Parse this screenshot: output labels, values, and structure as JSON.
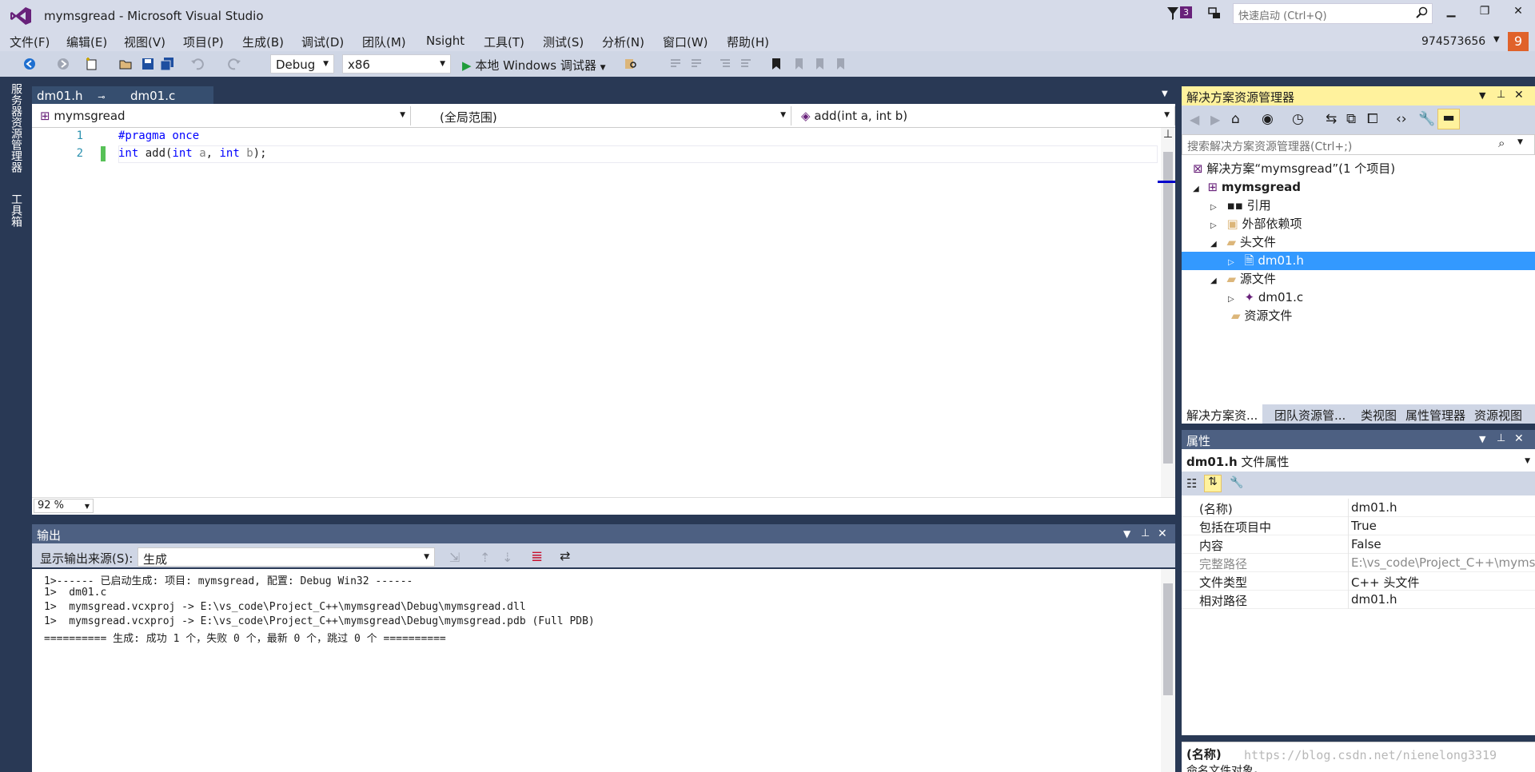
{
  "app": {
    "title": "mymsgread - Microsoft Visual Studio",
    "notification_count": "3",
    "quick_launch_placeholder": "快速启动 (Ctrl+Q)",
    "account": "974573656",
    "avatar_letter": "9"
  },
  "menu": [
    "文件(F)",
    "编辑(E)",
    "视图(V)",
    "项目(P)",
    "生成(B)",
    "调试(D)",
    "团队(M)",
    "Nsight",
    "工具(T)",
    "测试(S)",
    "分析(N)",
    "窗口(W)",
    "帮助(H)"
  ],
  "toolbar": {
    "config": "Debug",
    "platform": "x86",
    "run_label": "本地 Windows 调试器"
  },
  "left_rail": [
    "服务器资源管理器",
    "工具箱"
  ],
  "editor": {
    "tabs": [
      {
        "label": "dm01.h",
        "active": true
      },
      {
        "label": "dm01.c",
        "active": false
      }
    ],
    "nav_project": "mymsgread",
    "nav_scope": "(全局范围)",
    "nav_member": "add(int a, int b)",
    "lines": [
      {
        "num": "1",
        "text": "#pragma once"
      },
      {
        "num": "2",
        "text": "int add(int a, int b);"
      }
    ],
    "zoom": "92 %"
  },
  "output": {
    "title": "输出",
    "source_label": "显示输出来源(S):",
    "source_value": "生成",
    "lines": [
      "1>------ 已启动生成: 项目: mymsgread, 配置: Debug Win32 ------",
      "1>  dm01.c",
      "1>  mymsgread.vcxproj -> E:\\vs_code\\Project_C++\\mymsgread\\Debug\\mymsgread.dll",
      "1>  mymsgread.vcxproj -> E:\\vs_code\\Project_C++\\mymsgread\\Debug\\mymsgread.pdb (Full PDB)",
      "========== 生成: 成功 1 个，失败 0 个，最新 0 个，跳过 0 个 =========="
    ]
  },
  "solution_explorer": {
    "title": "解决方案资源管理器",
    "search_placeholder": "搜索解决方案资源管理器(Ctrl+;)",
    "nodes": [
      {
        "label": "解决方案“mymsgread”(1 个项目)",
        "depth": 0,
        "toggle": "",
        "icon": "solution-icon",
        "bold": false,
        "selected": false
      },
      {
        "label": "mymsgread",
        "depth": 1,
        "toggle": "◢",
        "icon": "project-icon",
        "bold": true,
        "selected": false
      },
      {
        "label": "引用",
        "depth": 2,
        "toggle": "▷",
        "icon": "references-icon",
        "bold": false,
        "selected": false
      },
      {
        "label": "外部依赖项",
        "depth": 2,
        "toggle": "▷",
        "icon": "external-deps-icon",
        "bold": false,
        "selected": false
      },
      {
        "label": "头文件",
        "depth": 2,
        "toggle": "◢",
        "icon": "folder-icon",
        "bold": false,
        "selected": false
      },
      {
        "label": "dm01.h",
        "depth": 3,
        "toggle": "▷",
        "icon": "header-file-icon",
        "bold": false,
        "selected": true
      },
      {
        "label": "源文件",
        "depth": 2,
        "toggle": "◢",
        "icon": "folder-icon",
        "bold": false,
        "selected": false
      },
      {
        "label": "dm01.c",
        "depth": 3,
        "toggle": "▷",
        "icon": "c-file-icon",
        "bold": false,
        "selected": false
      },
      {
        "label": "资源文件",
        "depth": 2,
        "toggle": "",
        "icon": "folder-icon",
        "bold": false,
        "selected": false
      }
    ],
    "bottom_tabs": [
      "解决方案资...",
      "团队资源管...",
      "类视图",
      "属性管理器",
      "资源视图"
    ]
  },
  "properties": {
    "title": "属性",
    "object_name": "dm01.h",
    "object_type": "文件属性",
    "rows": [
      {
        "key": "(名称)",
        "value": "dm01.h",
        "dim": false
      },
      {
        "key": "包括在项目中",
        "value": "True",
        "dim": false
      },
      {
        "key": "内容",
        "value": "False",
        "dim": false
      },
      {
        "key": "完整路径",
        "value": "E:\\vs_code\\Project_C++\\myms",
        "dim": true
      },
      {
        "key": "文件类型",
        "value": "C++ 头文件",
        "dim": false
      },
      {
        "key": "相对路径",
        "value": "dm01.h",
        "dim": false
      }
    ],
    "desc_name": "(名称)",
    "desc_text": "命名文件对象。"
  },
  "watermark": "https://blog.csdn.net/nienelong3319"
}
